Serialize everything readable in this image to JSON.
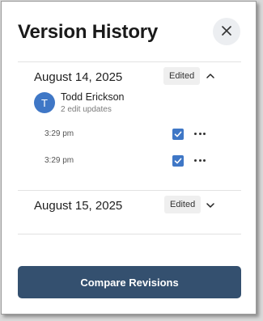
{
  "dialog": {
    "title": "Version History",
    "close_icon": "close-icon"
  },
  "groups": [
    {
      "date": "August 14, 2025",
      "badge": "Edited",
      "expanded": true,
      "user": {
        "initial": "T",
        "name": "Todd Erickson",
        "summary": "2 edit updates",
        "avatar_color": "#3f77c6"
      },
      "revisions": [
        {
          "time": "3:29 pm",
          "checked": true
        },
        {
          "time": "3:29 pm",
          "checked": true
        }
      ]
    },
    {
      "date": "August 15, 2025",
      "badge": "Edited",
      "expanded": false
    }
  ],
  "footer": {
    "compare_label": "Compare Revisions",
    "button_color": "#34506f"
  },
  "colors": {
    "checkbox": "#3f77c6",
    "badge_bg": "#efefef",
    "close_bg": "#eceef1"
  }
}
